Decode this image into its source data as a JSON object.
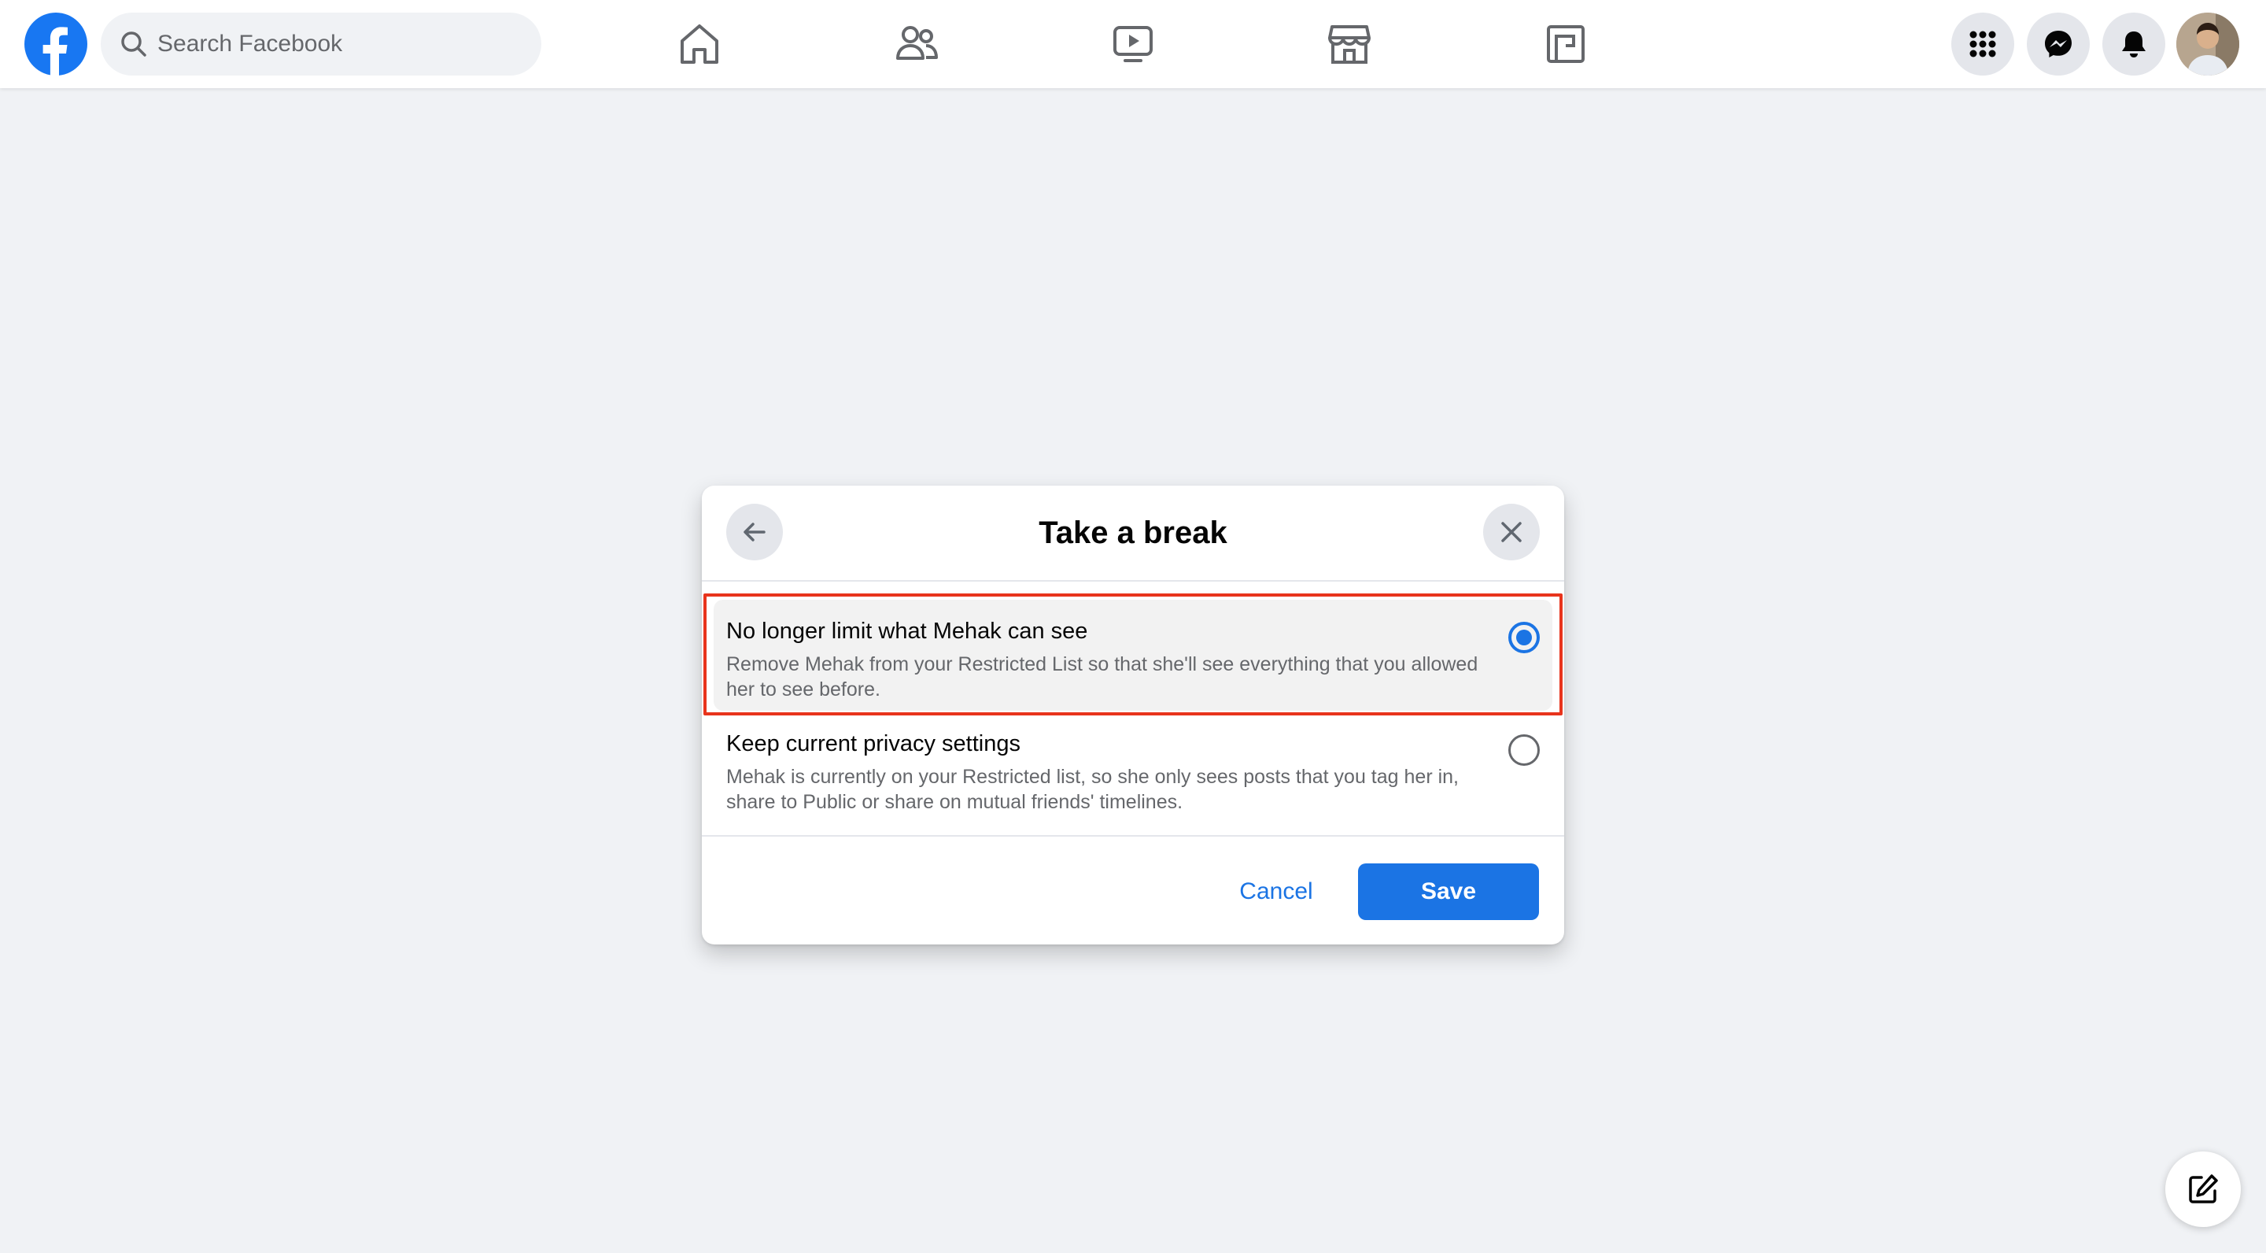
{
  "search": {
    "placeholder": "Search Facebook"
  },
  "nav": {
    "icons": [
      "home-icon",
      "friends-icon",
      "watch-icon",
      "marketplace-icon",
      "gaming-icon"
    ]
  },
  "header_actions": [
    "menu-grid-icon",
    "messenger-icon",
    "notifications-icon",
    "avatar"
  ],
  "dialog": {
    "title": "Take a break",
    "options": [
      {
        "title": "No longer limit what Mehak can see",
        "description": "Remove Mehak from your Restricted List so that she'll see everything that you allowed her to see before.",
        "selected": true
      },
      {
        "title": "Keep current privacy settings",
        "description": "Mehak is currently on your Restricted list, so she only sees posts that you tag her in, share to Public or share on mutual friends' timelines.",
        "selected": false
      }
    ],
    "cancel_label": "Cancel",
    "save_label": "Save"
  },
  "colors": {
    "brand": "#1877f2",
    "accent": "#1b74e4",
    "highlight": "#e8341c",
    "background": "#f0f2f5"
  }
}
